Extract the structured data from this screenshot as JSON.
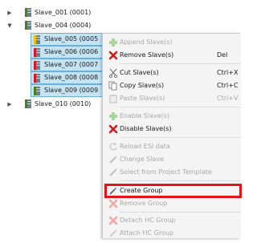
{
  "tree": [
    {
      "label": "Slave_001 (0001)",
      "arrow": "▶",
      "iconColor": "#4a7f1a"
    },
    {
      "label": "Slave_004 (0004)",
      "arrow": "▼",
      "iconColor": "#4a7f1a"
    },
    {
      "label": "Slave_005 (0005",
      "arrow": "",
      "iconColor": "#f2c200"
    },
    {
      "label": "Slave_006 (0006",
      "arrow": "",
      "iconColor": "#d9141b"
    },
    {
      "label": "Slave_007 (0007",
      "arrow": "",
      "iconColor": "#d9141b"
    },
    {
      "label": "Slave_008 (0008",
      "arrow": "",
      "iconColor": "#d9141b"
    },
    {
      "label": "Slave_009 (0009",
      "arrow": "",
      "iconColor": "#4a7f1a"
    },
    {
      "label": "Slave_010 (0010)",
      "arrow": "▶",
      "iconColor": "#4a7f1a"
    }
  ],
  "menu": {
    "items": [
      {
        "label": "Append Slave(s)",
        "shortcut": "",
        "enabled": false,
        "icon": "plus-icon"
      },
      {
        "label": "Remove Slave(s)",
        "shortcut": "Del",
        "enabled": true,
        "icon": "remove-x-icon"
      },
      {
        "label": "Cut Slave(s)",
        "shortcut": "Ctrl+X",
        "enabled": true,
        "icon": "scissors-icon"
      },
      {
        "label": "Copy Slave(s)",
        "shortcut": "Ctrl+C",
        "enabled": true,
        "icon": "copy-icon"
      },
      {
        "label": "Paste Slave(s)",
        "shortcut": "Ctrl+V",
        "enabled": false,
        "icon": "paste-icon"
      },
      {
        "label": "Enable Slave(s)",
        "shortcut": "",
        "enabled": false,
        "icon": "plus-icon"
      },
      {
        "label": "Disable Slave(s)",
        "shortcut": "",
        "enabled": true,
        "icon": "remove-x-icon"
      },
      {
        "label": "Reload ESI data",
        "shortcut": "",
        "enabled": false,
        "icon": "reload-icon"
      },
      {
        "label": "Change Slave",
        "shortcut": "",
        "enabled": false,
        "icon": "pencil-icon"
      },
      {
        "label": "Select from Project Template",
        "shortcut": "",
        "enabled": false,
        "icon": "pencil-icon"
      },
      {
        "label": "Create Group",
        "shortcut": "",
        "enabled": true,
        "icon": "wand-icon"
      },
      {
        "label": "Remove Group",
        "shortcut": "",
        "enabled": false,
        "icon": "remove-x-icon"
      },
      {
        "label": "Detach HC Group",
        "shortcut": "",
        "enabled": false,
        "icon": "remove-x-icon"
      },
      {
        "label": "Attach HC Group",
        "shortcut": "",
        "enabled": false,
        "icon": "wand-icon"
      }
    ]
  },
  "colors": {
    "highlight": "#e3141b",
    "selection": "#c4e4f4",
    "addGreen": "#4caf2a",
    "removeRed": "#d11a1a"
  }
}
